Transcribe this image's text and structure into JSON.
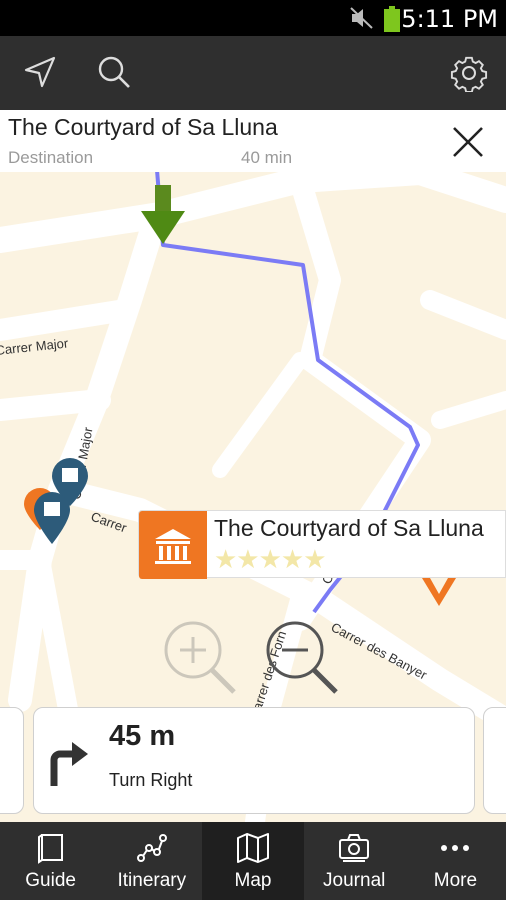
{
  "status": {
    "time": "5:11 PM"
  },
  "toolbar": {
    "locate_icon": "navigation-arrow-icon",
    "search_icon": "search-icon",
    "settings_icon": "gear-icon"
  },
  "destination": {
    "title": "The Courtyard of Sa Lluna",
    "label": "Destination",
    "duration": "40 min"
  },
  "map": {
    "streets": [
      "Carrer Major",
      "Carrer Major",
      "Carrer",
      "Carrer Diego",
      "Carrer des Banyer",
      "Carrer des Forn"
    ],
    "route_color": "#7b7bf5",
    "marker_color": "#2d5b7a",
    "accent": "#ef7622"
  },
  "poi": {
    "name": "The Courtyard of Sa Lluna",
    "stars": "★★★★★",
    "rating": 5
  },
  "instruction": {
    "distance": "45 m",
    "action": "Turn Right"
  },
  "nav": [
    {
      "label": "Guide",
      "icon": "book-icon"
    },
    {
      "label": "Itinerary",
      "icon": "itinerary-icon"
    },
    {
      "label": "Map",
      "icon": "map-icon"
    },
    {
      "label": "Journal",
      "icon": "camera-icon"
    },
    {
      "label": "More",
      "icon": "more-icon"
    }
  ]
}
